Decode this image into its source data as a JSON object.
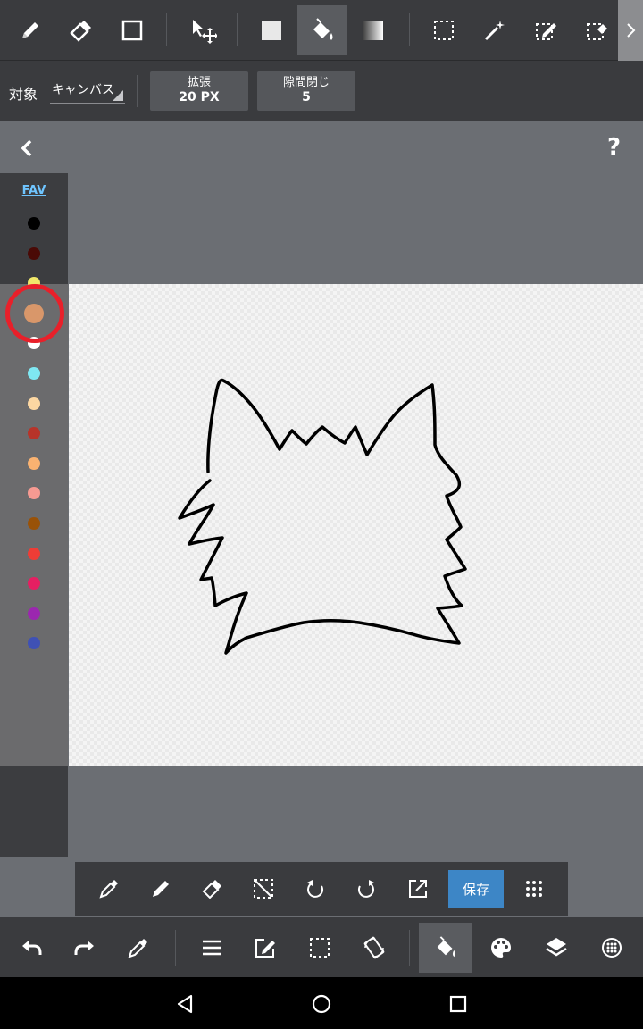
{
  "toolbar": {
    "tools": [
      "pen-icon",
      "eraser-icon",
      "rect-shape-icon",
      "move-transform-icon",
      "fill-color-icon",
      "bucket-icon",
      "gradient-icon",
      "select-rect-icon",
      "magic-wand-icon",
      "select-pen-icon",
      "select-eraser-icon"
    ],
    "active_tool": "bucket-icon"
  },
  "options": {
    "target_label": "対象",
    "target_value": "キャンバス",
    "expand_title": "拡張",
    "expand_value": "20 PX",
    "gap_title": "隙間閉じ",
    "gap_value": "5"
  },
  "palette": {
    "fav_label": "FAV",
    "colors": [
      "#000000",
      "#4a0a06",
      "#f1e86a",
      "#d9976a",
      "#ffffff",
      "#7fe7f2",
      "#fcd7a2",
      "#b7342a",
      "#f9b271",
      "#f69a92",
      "#995208",
      "#ee3d36",
      "#e51f62",
      "#9b27af",
      "#3f51b5"
    ],
    "selected_color": "#d9976a"
  },
  "subbar": {
    "save_label": "保存",
    "icons": [
      "eyedropper-icon",
      "pen-icon",
      "eraser-icon",
      "deselect-icon",
      "rotate-left-icon",
      "rotate-right-icon",
      "export-icon",
      "grid-icon"
    ]
  },
  "bottombar": {
    "icons": [
      "undo-icon",
      "redo-icon",
      "eyedropper-icon",
      "menu-icon",
      "edit-icon",
      "selection-icon",
      "rotate-canvas-icon",
      "bucket-icon",
      "palette-icon",
      "layers-icon",
      "brush-settings-icon"
    ],
    "active": "bucket-icon"
  },
  "navbar": {
    "icons": [
      "back-triangle-icon",
      "home-circle-icon",
      "recents-square-icon"
    ]
  },
  "help_label": "?"
}
